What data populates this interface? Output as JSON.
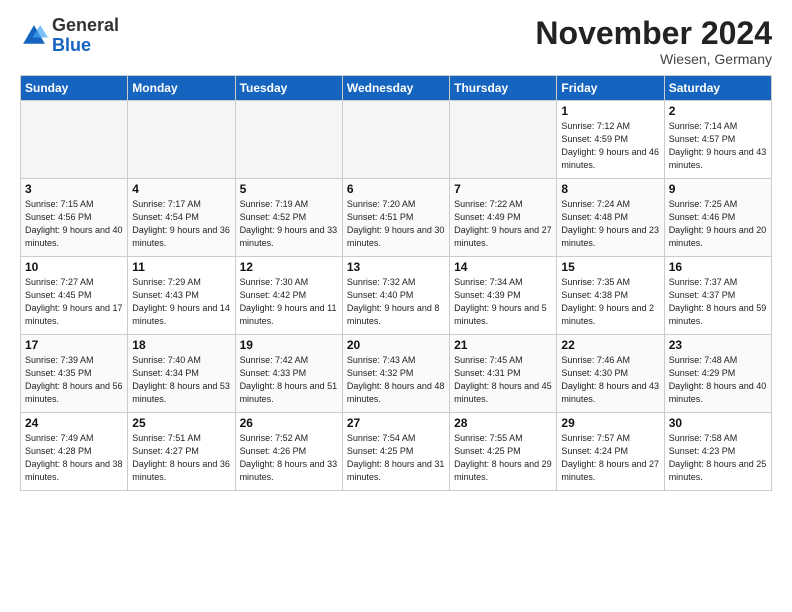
{
  "header": {
    "logo_general": "General",
    "logo_blue": "Blue",
    "month_title": "November 2024",
    "subtitle": "Wiesen, Germany"
  },
  "weekdays": [
    "Sunday",
    "Monday",
    "Tuesday",
    "Wednesday",
    "Thursday",
    "Friday",
    "Saturday"
  ],
  "weeks": [
    [
      {
        "day": "",
        "info": ""
      },
      {
        "day": "",
        "info": ""
      },
      {
        "day": "",
        "info": ""
      },
      {
        "day": "",
        "info": ""
      },
      {
        "day": "",
        "info": ""
      },
      {
        "day": "1",
        "info": "Sunrise: 7:12 AM\nSunset: 4:59 PM\nDaylight: 9 hours and 46 minutes."
      },
      {
        "day": "2",
        "info": "Sunrise: 7:14 AM\nSunset: 4:57 PM\nDaylight: 9 hours and 43 minutes."
      }
    ],
    [
      {
        "day": "3",
        "info": "Sunrise: 7:15 AM\nSunset: 4:56 PM\nDaylight: 9 hours and 40 minutes."
      },
      {
        "day": "4",
        "info": "Sunrise: 7:17 AM\nSunset: 4:54 PM\nDaylight: 9 hours and 36 minutes."
      },
      {
        "day": "5",
        "info": "Sunrise: 7:19 AM\nSunset: 4:52 PM\nDaylight: 9 hours and 33 minutes."
      },
      {
        "day": "6",
        "info": "Sunrise: 7:20 AM\nSunset: 4:51 PM\nDaylight: 9 hours and 30 minutes."
      },
      {
        "day": "7",
        "info": "Sunrise: 7:22 AM\nSunset: 4:49 PM\nDaylight: 9 hours and 27 minutes."
      },
      {
        "day": "8",
        "info": "Sunrise: 7:24 AM\nSunset: 4:48 PM\nDaylight: 9 hours and 23 minutes."
      },
      {
        "day": "9",
        "info": "Sunrise: 7:25 AM\nSunset: 4:46 PM\nDaylight: 9 hours and 20 minutes."
      }
    ],
    [
      {
        "day": "10",
        "info": "Sunrise: 7:27 AM\nSunset: 4:45 PM\nDaylight: 9 hours and 17 minutes."
      },
      {
        "day": "11",
        "info": "Sunrise: 7:29 AM\nSunset: 4:43 PM\nDaylight: 9 hours and 14 minutes."
      },
      {
        "day": "12",
        "info": "Sunrise: 7:30 AM\nSunset: 4:42 PM\nDaylight: 9 hours and 11 minutes."
      },
      {
        "day": "13",
        "info": "Sunrise: 7:32 AM\nSunset: 4:40 PM\nDaylight: 9 hours and 8 minutes."
      },
      {
        "day": "14",
        "info": "Sunrise: 7:34 AM\nSunset: 4:39 PM\nDaylight: 9 hours and 5 minutes."
      },
      {
        "day": "15",
        "info": "Sunrise: 7:35 AM\nSunset: 4:38 PM\nDaylight: 9 hours and 2 minutes."
      },
      {
        "day": "16",
        "info": "Sunrise: 7:37 AM\nSunset: 4:37 PM\nDaylight: 8 hours and 59 minutes."
      }
    ],
    [
      {
        "day": "17",
        "info": "Sunrise: 7:39 AM\nSunset: 4:35 PM\nDaylight: 8 hours and 56 minutes."
      },
      {
        "day": "18",
        "info": "Sunrise: 7:40 AM\nSunset: 4:34 PM\nDaylight: 8 hours and 53 minutes."
      },
      {
        "day": "19",
        "info": "Sunrise: 7:42 AM\nSunset: 4:33 PM\nDaylight: 8 hours and 51 minutes."
      },
      {
        "day": "20",
        "info": "Sunrise: 7:43 AM\nSunset: 4:32 PM\nDaylight: 8 hours and 48 minutes."
      },
      {
        "day": "21",
        "info": "Sunrise: 7:45 AM\nSunset: 4:31 PM\nDaylight: 8 hours and 45 minutes."
      },
      {
        "day": "22",
        "info": "Sunrise: 7:46 AM\nSunset: 4:30 PM\nDaylight: 8 hours and 43 minutes."
      },
      {
        "day": "23",
        "info": "Sunrise: 7:48 AM\nSunset: 4:29 PM\nDaylight: 8 hours and 40 minutes."
      }
    ],
    [
      {
        "day": "24",
        "info": "Sunrise: 7:49 AM\nSunset: 4:28 PM\nDaylight: 8 hours and 38 minutes."
      },
      {
        "day": "25",
        "info": "Sunrise: 7:51 AM\nSunset: 4:27 PM\nDaylight: 8 hours and 36 minutes."
      },
      {
        "day": "26",
        "info": "Sunrise: 7:52 AM\nSunset: 4:26 PM\nDaylight: 8 hours and 33 minutes."
      },
      {
        "day": "27",
        "info": "Sunrise: 7:54 AM\nSunset: 4:25 PM\nDaylight: 8 hours and 31 minutes."
      },
      {
        "day": "28",
        "info": "Sunrise: 7:55 AM\nSunset: 4:25 PM\nDaylight: 8 hours and 29 minutes."
      },
      {
        "day": "29",
        "info": "Sunrise: 7:57 AM\nSunset: 4:24 PM\nDaylight: 8 hours and 27 minutes."
      },
      {
        "day": "30",
        "info": "Sunrise: 7:58 AM\nSunset: 4:23 PM\nDaylight: 8 hours and 25 minutes."
      }
    ]
  ]
}
